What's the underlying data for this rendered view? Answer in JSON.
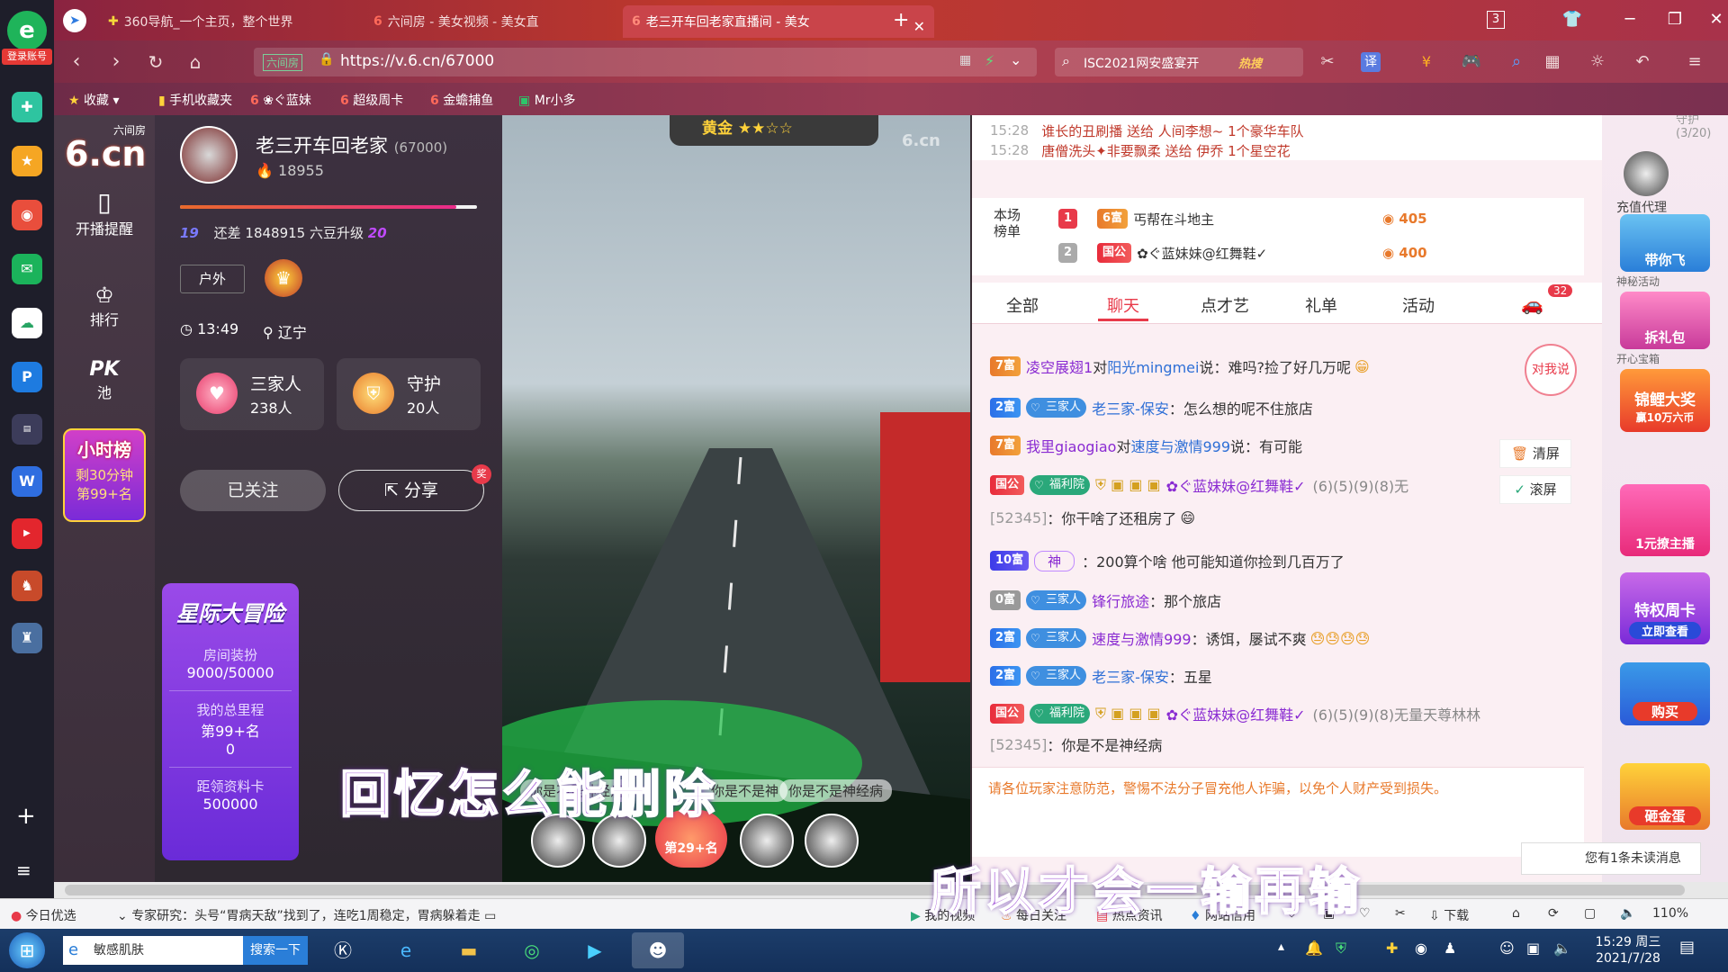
{
  "browser": {
    "tabs": [
      "360导航_一个主页，整个世界",
      "六间房 - 美女视频 - 美女直",
      "老三开车回老家直播间 - 美女"
    ],
    "tab_count": "3",
    "url": "https://v.6.cn/67000",
    "url_badge": "六间房",
    "search_text": "ISC2021网安盛宴开",
    "search_hot": "热搜",
    "zoom": "110%"
  },
  "bookmarks": [
    "收藏",
    "手机收藏夹",
    "❀ぐ蓝妹",
    "超级周卡",
    "金蟾捕鱼",
    "Mr小多"
  ],
  "leftbar": {
    "login": "登录账号"
  },
  "site_nav": {
    "logo_top": "六间房",
    "logo": "6.cn",
    "items": [
      "开播提醒",
      "排行",
      "PK",
      "池"
    ],
    "hourly": {
      "title": "小时榜",
      "remain": "剩30分钟",
      "rank": "第99+名"
    }
  },
  "anchor": {
    "name": "老三开车回老家",
    "room_id": "(67000)",
    "fans": "18955",
    "level_from": "19",
    "level_text": "还差 1848915 六豆升级",
    "level_to": "20",
    "tag": "户外",
    "time": "13:49",
    "location": "辽宁",
    "family": {
      "label": "三家人",
      "count": "238人"
    },
    "guard": {
      "label": "守护",
      "count": "20人"
    },
    "follow": "已关注",
    "share": "分享",
    "share_badge": "奖"
  },
  "event": {
    "title": "星际大冒险",
    "deco_label": "房间装扮",
    "deco_value": "9000/50000",
    "mileage_label": "我的总里程",
    "mileage_rank": "第99+名",
    "mileage_value": "0",
    "card_label": "距领资料卡",
    "card_value": "500000"
  },
  "video": {
    "rank_badge": "黄金",
    "watermark": "6.cn",
    "danmaku": [
      "你是不是神经病",
      "你是不是神",
      "你是不是神经病"
    ],
    "rank_center": "第29+名",
    "subtitle1": "回忆怎么能删除",
    "subtitle2": "所以才会一输再输"
  },
  "gift_feed": [
    {
      "time": "15:28",
      "text": "谁长的丑刷播 送给 人间李想~ 1个豪华车队"
    },
    {
      "time": "15:28",
      "text": "唐僧洗头✦非要飘柔 送给 伊乔 1个星空花"
    }
  ],
  "leaderboard": {
    "label": "本场榜单",
    "rows": [
      {
        "rank": "1",
        "badge": "6富",
        "name": "丐帮在斗地主",
        "score": "405"
      },
      {
        "rank": "2",
        "badge": "国公",
        "name": "✿ぐ蓝妹妹@红舞鞋✓",
        "score": "400"
      }
    ]
  },
  "chat_tabs": [
    "全部",
    "聊天",
    "点才艺",
    "礼单",
    "活动"
  ],
  "chat_badge": "32",
  "chat_side": {
    "talk": "对我说",
    "clear": "清屏",
    "scroll": "滚屏"
  },
  "chat": [
    {
      "badge": "7富",
      "user": "凌空展翅1",
      "mid": " 对 ",
      "target": "阳光mingmei",
      "text": " 说：难吗?捡了好几万呢"
    },
    {
      "badge": "2富",
      "fam": "三家人",
      "user": "老三家-保安",
      "text": "：怎么想的呢不住旅店"
    },
    {
      "badge": "7富",
      "user": "我里giaogiao",
      "mid": " 对 ",
      "target": "速度与激情999",
      "text": " 说：有可能"
    },
    {
      "badge": "国公",
      "fam": "福利院",
      "user": "✿ぐ蓝妹妹@红舞鞋✓",
      "extra": "(6)(5)(9)(8)无"
    },
    {
      "id": "[52345]",
      "text": "：你干啥了还租房了"
    },
    {
      "badge": "10富",
      "user": "神",
      "text": "：200算个啥 他可能知道你捡到几百万了"
    },
    {
      "badge": "0富",
      "fam": "三家人",
      "user": "锋行旅途",
      "text": "：那个旅店"
    },
    {
      "badge": "2富",
      "fam": "三家人",
      "user": "速度与激情999",
      "text": "：诱饵，屡试不爽"
    },
    {
      "badge": "2富",
      "fam": "三家人",
      "user": "老三家-保安",
      "text": "：五星"
    },
    {
      "badge": "国公",
      "fam": "福利院",
      "user": "✿ぐ蓝妹妹@红舞鞋✓",
      "extra": "(6)(5)(9)(8)无量天尊林林"
    },
    {
      "id": "[52345]",
      "text": "：你是不是神经病"
    }
  ],
  "notice": "请各位玩家注意防范，警惕不法分子冒充他人诈骗，以免个人财产受到损失。",
  "unread": "您有1条未读消息",
  "right_rail": {
    "guard_count": "守护(3/20)",
    "items": [
      "充值代理",
      "带你飞",
      "神秘活动",
      "拆礼包",
      "开心宝箱",
      "锦鲤大奖",
      "赢10万六币",
      "1元撩主播",
      "特权周卡",
      "立即查看",
      "购买",
      "砸金蛋"
    ]
  },
  "statusbar": {
    "left": "今日优选",
    "news": "专家研究：头号“胃病天敌”找到了，连吃1周稳定，胃病躲着走",
    "items": [
      "我的视频",
      "每日关注",
      "热点资讯",
      "网站信用",
      "下载"
    ]
  },
  "taskbar": {
    "search_text": "敏感肌肤",
    "search_btn": "搜索一下",
    "time": "15:29 周三",
    "date": "2021/7/28"
  }
}
